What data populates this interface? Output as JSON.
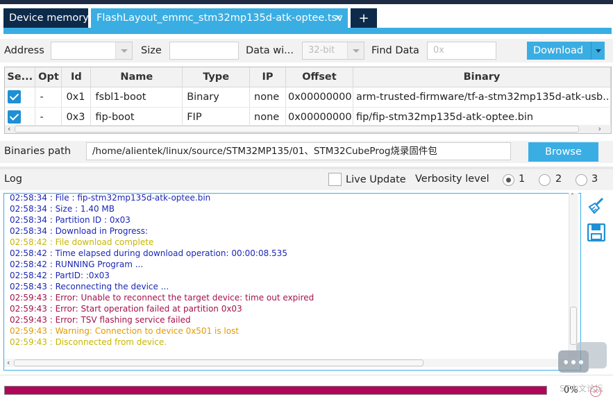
{
  "tabs": {
    "device_memory": "Device memory",
    "flash_layout": "FlashLayout_emmc_stm32mp135d-atk-optee.tsv",
    "close": "×",
    "add": "+"
  },
  "filter": {
    "address_label": "Address",
    "size_label": "Size",
    "data_width_label": "Data wi...",
    "data_width_value": "32-bit",
    "find_data_label": "Find Data",
    "find_data_placeholder": "0x",
    "download_label": "Download"
  },
  "table": {
    "headers": [
      "Se...",
      "Opt",
      "Id",
      "Name",
      "Type",
      "IP",
      "Offset",
      "Binary"
    ],
    "rows": [
      {
        "selected": true,
        "opt": "-",
        "id": "0x1",
        "name": "fsbl1-boot",
        "type": "Binary",
        "ip": "none",
        "offset": "0x00000000",
        "binary": "arm-trusted-firmware/tf-a-stm32mp135d-atk-usb.."
      },
      {
        "selected": true,
        "opt": "-",
        "id": "0x3",
        "name": "fip-boot",
        "type": "FIP",
        "ip": "none",
        "offset": "0x00000000",
        "binary": "fip/fip-stm32mp135d-atk-optee.bin"
      }
    ]
  },
  "binaries": {
    "label": "Binaries path",
    "path": "/home/alientek/linux/source/STM32MP135/01、STM32CubeProg烧录固件包",
    "browse_label": "Browse"
  },
  "log": {
    "title": "Log",
    "live_update_label": "Live Update",
    "verbosity_label": "Verbosity level",
    "verbosity_options": [
      "1",
      "2",
      "3"
    ],
    "verbosity_selected": "1",
    "lines": [
      {
        "text": "02:58:34 :   File          : fip-stm32mp135d-atk-optee.bin",
        "level": "info"
      },
      {
        "text": "02:58:34 :   Size          : 1.40 MB",
        "level": "info"
      },
      {
        "text": "02:58:34 :   Partition ID  : 0x03",
        "level": "info"
      },
      {
        "text": "02:58:34 : Download in Progress:",
        "level": "info"
      },
      {
        "text": "02:58:42 : File download complete",
        "level": "success"
      },
      {
        "text": "02:58:42 : Time elapsed during download operation: 00:00:08.535",
        "level": "info"
      },
      {
        "text": "02:58:42 : RUNNING Program ...",
        "level": "info"
      },
      {
        "text": "02:58:42 :   PartID:      :0x03",
        "level": "info"
      },
      {
        "text": "02:58:43 : Reconnecting the device ...",
        "level": "info"
      },
      {
        "text": "02:59:43 : Error: Unable to reconnect the target device: time out expired",
        "level": "error"
      },
      {
        "text": "02:59:43 : Error: Start operation failed at partition 0x03",
        "level": "error"
      },
      {
        "text": "02:59:43 : Error: TSV flashing service failed",
        "level": "error"
      },
      {
        "text": "02:59:43 : Warning: Connection to device 0x501 is lost",
        "level": "warning"
      },
      {
        "text": "02:59:43 : Disconnected from device.",
        "level": "success"
      }
    ]
  },
  "progress": {
    "value_percent": 0,
    "label": "0%"
  },
  "watermark": "ST中文论坛",
  "colors": {
    "accent": "#3aaee3",
    "dark": "#0d2a4a",
    "progress": "#b0065a",
    "info": "#1a27b5",
    "success": "#c6b600",
    "error": "#a3124a",
    "warning": "#e19b00"
  }
}
